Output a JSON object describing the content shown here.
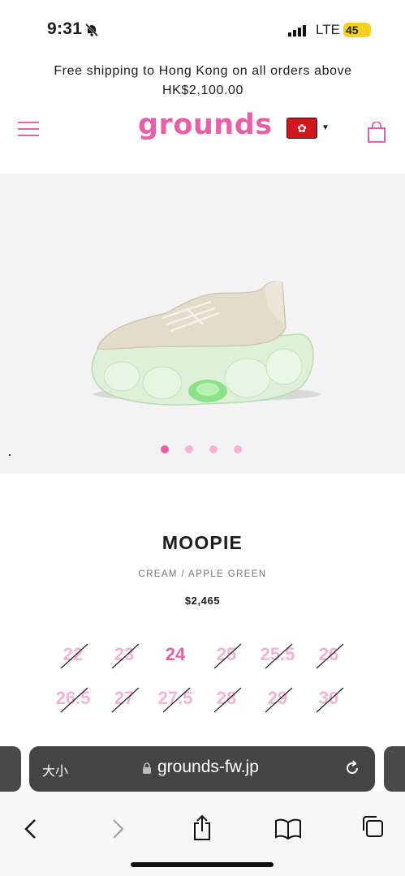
{
  "status_bar": {
    "time": "9:31",
    "network": "LTE",
    "battery": "45"
  },
  "announcement": {
    "text": "Free shipping to Hong Kong on all orders above HK$2,100.00"
  },
  "header": {
    "logo": "grounds"
  },
  "colors": {
    "brand_pink": "#e65fa7",
    "light_pink": "#f2b4d3",
    "flag_red": "#d2161e"
  },
  "carousel": {
    "slide_count": 4,
    "active_index": 0
  },
  "product": {
    "title": "MOOPIE",
    "color": "CREAM / APPLE GREEN",
    "price": "$2,465"
  },
  "sizes": [
    {
      "label": "22",
      "available": false
    },
    {
      "label": "23",
      "available": false
    },
    {
      "label": "24",
      "available": true
    },
    {
      "label": "25",
      "available": false
    },
    {
      "label": "25.5",
      "available": false
    },
    {
      "label": "26",
      "available": false
    },
    {
      "label": "26.5",
      "available": false
    },
    {
      "label": "27",
      "available": false
    },
    {
      "label": "27.5",
      "available": false
    },
    {
      "label": "28",
      "available": false
    },
    {
      "label": "29",
      "available": false
    },
    {
      "label": "30",
      "available": false
    }
  ],
  "browser": {
    "text_size_label": "大小",
    "url": "grounds-fw.jp"
  },
  "icons": {
    "menu": "hamburger-icon",
    "bag": "shopping-bag-icon",
    "flag": "hong-kong-flag-icon",
    "back": "chevron-left-icon",
    "forward": "chevron-right-icon",
    "share": "share-icon",
    "bookmarks": "book-icon",
    "tabs": "tabs-icon"
  }
}
